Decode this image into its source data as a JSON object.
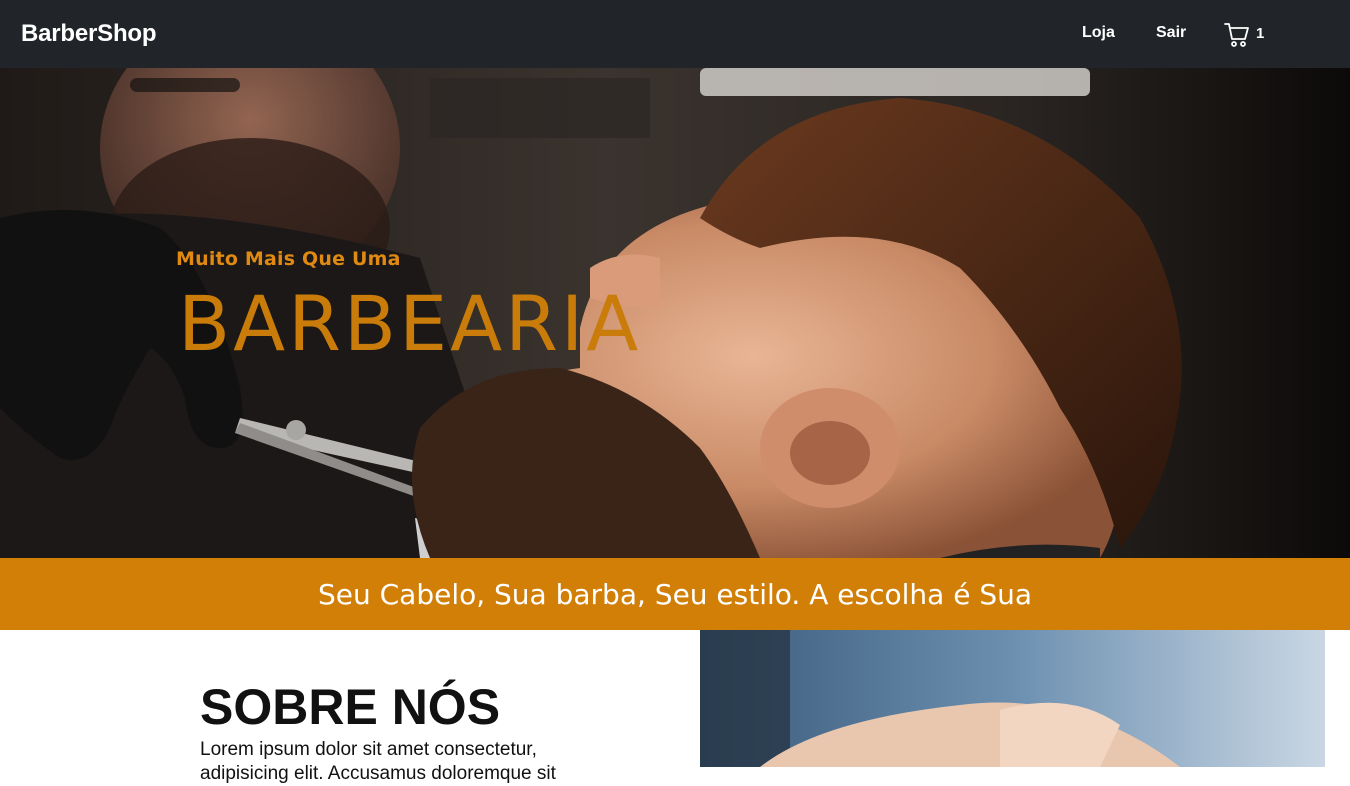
{
  "navbar": {
    "brand": "BarberShop",
    "links": [
      {
        "label": "Loja"
      },
      {
        "label": "Sair"
      }
    ],
    "cart": {
      "icon": "cart-icon",
      "count": "1"
    }
  },
  "hero": {
    "subtitle": "Muito Mais Que Uma",
    "title": "BARBEARIA",
    "image": "barber trimming beard with scissors"
  },
  "band": {
    "text": "Seu Cabelo, Sua barba, Seu estilo. A escolha é Sua"
  },
  "about": {
    "title": "SOBRE NÓS",
    "text": "Lorem ipsum dolor sit amet consectetur, adipisicing elit. Accusamus doloremque sit",
    "image": "barber shaving client"
  },
  "colors": {
    "navbar": "#212529",
    "accent": "#d17f07",
    "hero_text": "#c97c0a"
  }
}
